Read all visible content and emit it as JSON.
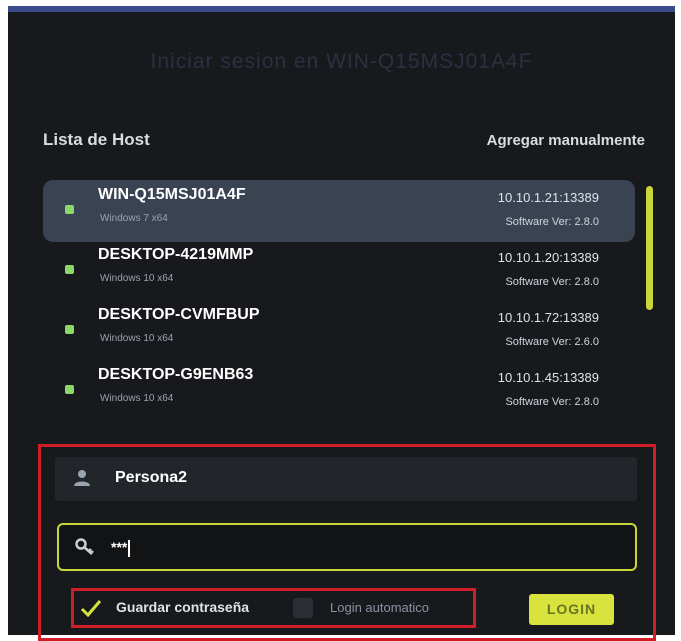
{
  "window": {
    "title": "Iniciar sesion en WIN-Q15MSJ01A4F"
  },
  "hosts": {
    "title": "Lista de Host",
    "add_manual": "Agregar manualmente",
    "items": [
      {
        "name": "WIN-Q15MSJ01A4F",
        "os": "Windows 7 x64",
        "ip": "10.10.1.21:13389",
        "version": "Software Ver: 2.8.0",
        "selected": true
      },
      {
        "name": "DESKTOP-4219MMP",
        "os": "Windows 10 x64",
        "ip": "10.10.1.20:13389",
        "version": "Software Ver: 2.8.0",
        "selected": false
      },
      {
        "name": "DESKTOP-CVMFBUP",
        "os": "Windows 10 x64",
        "ip": "10.10.1.72:13389",
        "version": "Software Ver: 2.6.0",
        "selected": false
      },
      {
        "name": "DESKTOP-G9ENB63",
        "os": "Windows 10 x64",
        "ip": "10.10.1.45:13389",
        "version": "Software Ver: 2.8.0",
        "selected": false
      }
    ]
  },
  "login": {
    "username": "Persona2",
    "password_masked": "***",
    "save_password_label": "Guardar contraseña",
    "save_password_checked": true,
    "auto_login_label": "Login automatico",
    "auto_login_checked": false,
    "button_label": "LOGIN"
  },
  "icons": {
    "user": "user-icon",
    "key": "key-icon",
    "check": "check-icon"
  },
  "colors": {
    "accent": "#d8e33e",
    "highlight_border": "#d11d27",
    "selected_row": "#3a4352",
    "online": "#8ad86a"
  }
}
